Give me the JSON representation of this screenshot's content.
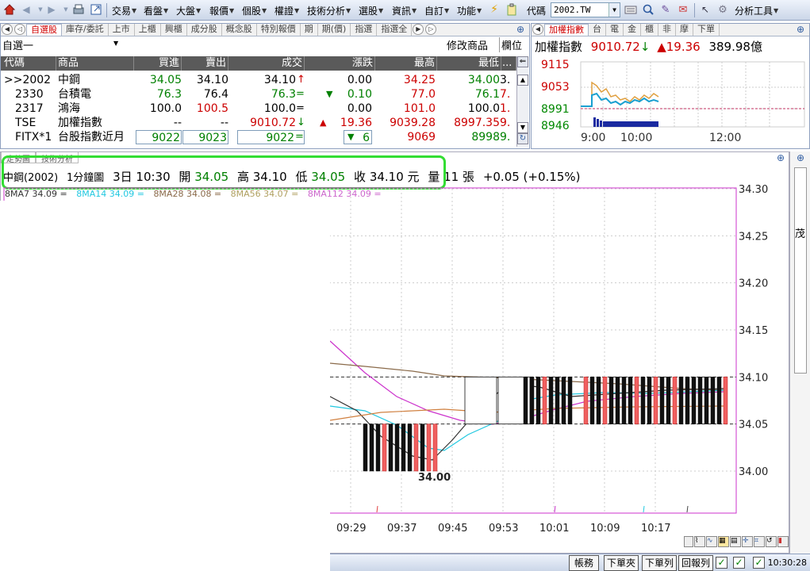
{
  "toolbar": {
    "menus": [
      "交易",
      "看盤",
      "大盤",
      "報價",
      "個股",
      "權證",
      "技術分析",
      "選股",
      "資訊",
      "自訂",
      "功能"
    ],
    "code_label": "代碼",
    "code_value": "2002.TW",
    "tools_label": "分析工具"
  },
  "quote_panel": {
    "tabs": [
      "自選股",
      "庫存/委託",
      "上市",
      "上櫃",
      "興櫃",
      "成分股",
      "概念股",
      "特別報價",
      "期",
      "期(價)",
      "指選",
      "指選全"
    ],
    "watchlist": "自選一",
    "modify_label": "修改商品",
    "columns_label": "欄位",
    "headers": [
      "代碼",
      "商品",
      "買進",
      "賣出",
      "成交",
      "漲跌",
      "最高",
      "最低"
    ],
    "rows": [
      {
        "code": ">>2002",
        "name": "中鋼",
        "bid": "34.05",
        "ask": "34.10",
        "last": "34.10",
        "chg": "0.00",
        "high": "34.25",
        "low": "34.00",
        "more": "3."
      },
      {
        "code": "2330",
        "name": "台積電",
        "bid": "76.3",
        "ask": "76.4",
        "last": "76.3",
        "chg": "0.10",
        "high": "77.0",
        "low": "76.1",
        "more": "7."
      },
      {
        "code": "2317",
        "name": "鴻海",
        "bid": "100.0",
        "ask": "100.5",
        "last": "100.0",
        "chg": "0.00",
        "high": "101.0",
        "low": "100.0",
        "more": "1."
      },
      {
        "code": "TSE",
        "name": "加權指數",
        "bid": "--",
        "ask": "--",
        "last": "9010.72",
        "chg": "19.36",
        "high": "9039.28",
        "low": "8997.35",
        "more": "9."
      },
      {
        "code": "FITX*1",
        "name": "台股指數近月",
        "bid": "9022",
        "ask": "9023",
        "last": "9022",
        "chg": "6",
        "high": "9069",
        "low": "8998",
        "more": "9."
      }
    ]
  },
  "index_panel": {
    "tabs": [
      "加權指數",
      "台",
      "電",
      "金",
      "櫃",
      "非",
      "摩",
      "下單"
    ],
    "name": "加權指數",
    "value": "9010.72",
    "change": "19.36",
    "volume": "389.98億",
    "y_ticks": [
      "9115",
      "9053",
      "8991",
      "8946"
    ],
    "x_ticks": [
      "9:00",
      "10:00",
      "12:00"
    ]
  },
  "chart_panel": {
    "tabs": [
      "走勢圖",
      "技術分析"
    ],
    "stock": "中鋼(2002)",
    "period": "1分鐘圖",
    "date_label": "3日",
    "time_label": "10:30",
    "open_label": "開",
    "open": "34.05",
    "high_label": "高",
    "high": "34.10",
    "low_label": "低",
    "low": "34.05",
    "close_label": "收",
    "close": "34.10",
    "unit": "元",
    "vol_label": "量",
    "volume": "11",
    "vol_unit": "張",
    "change": "+0.05 (+0.15%)",
    "ma": [
      "8MA7 34.09 =",
      "8MA14 34.09 =",
      "8MA28 34.08 =",
      "8MA56 34.07 =",
      "8MA112 34.09 ="
    ],
    "y_ticks": [
      "34.30",
      "34.25",
      "34.20",
      "34.15",
      "34.10",
      "34.05",
      "34.00"
    ],
    "x_ticks": [
      "09:29",
      "09:37",
      "09:45",
      "09:53",
      "10:01",
      "10:09",
      "10:17"
    ],
    "low_marker": "34.00",
    "side_label": "茂"
  },
  "statusbar": {
    "buttons": [
      "帳務",
      "下單夾",
      "下單列",
      "回報列"
    ],
    "clock": "10:30:28"
  },
  "colors": {
    "up": "#cc0000",
    "down": "#008000",
    "highlight": "#33dd33",
    "frame": "#cc33cc"
  }
}
